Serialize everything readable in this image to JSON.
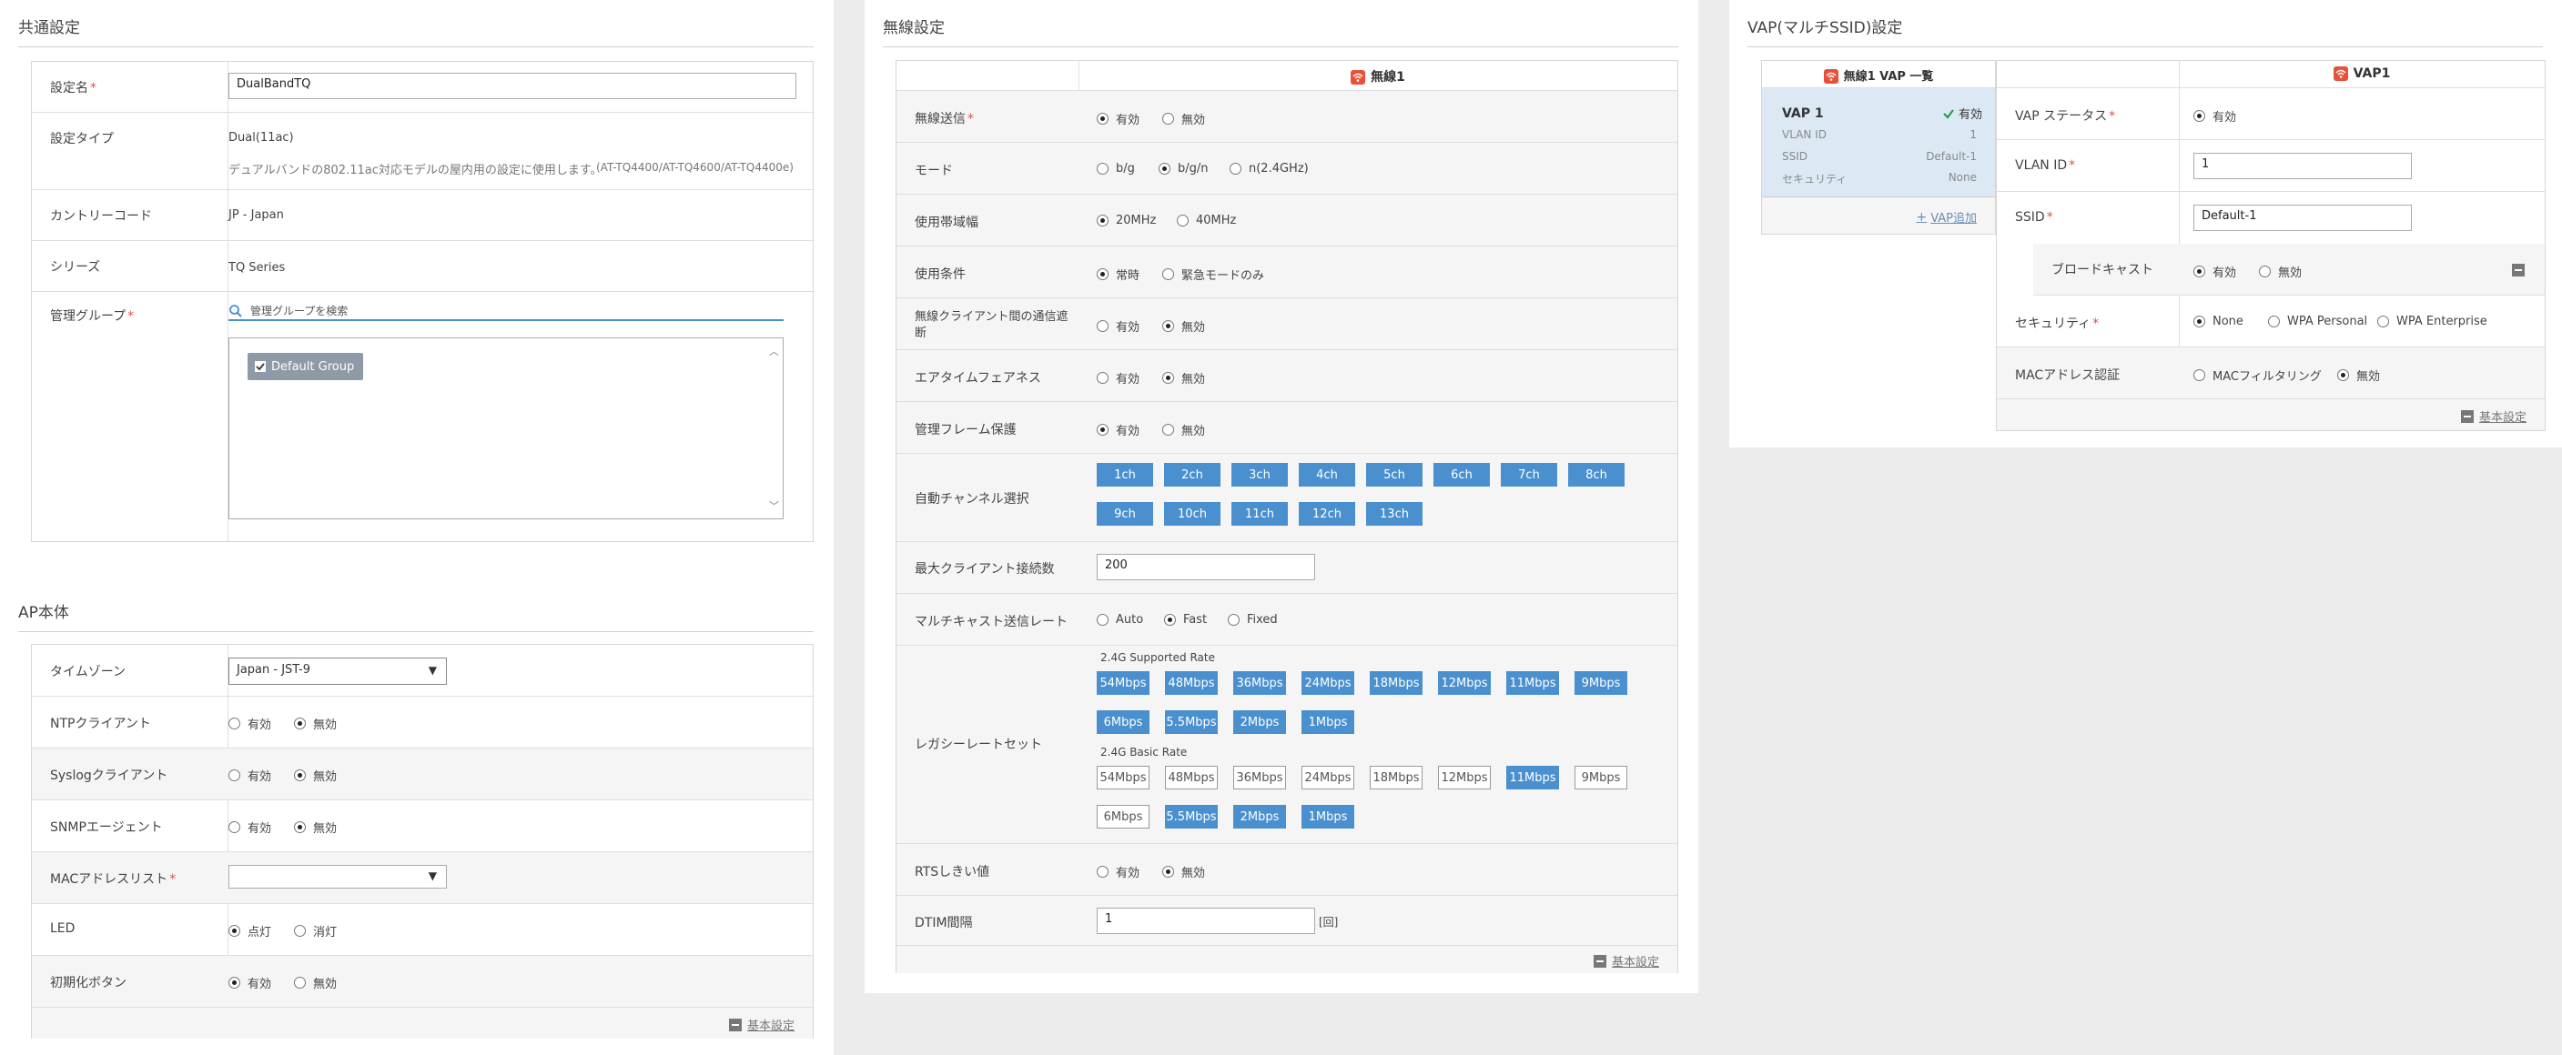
{
  "common": {
    "title": "共通設定",
    "name_label": "設定名",
    "name_value": "DualBandTQ",
    "type_label": "設定タイプ",
    "type_value": "Dual(11ac)",
    "type_desc": "デュアルバンドの802.11ac対応モデルの屋内用の設定に使用します。",
    "type_models": "(AT-TQ4400/AT-TQ4600/AT-TQ4400e)",
    "country_label": "カントリーコード",
    "country_value": "JP - Japan",
    "series_label": "シリーズ",
    "series_value": "TQ Series",
    "group_label": "管理グループ",
    "group_search_placeholder": "管理グループを検索",
    "group_item": "Default Group"
  },
  "ap": {
    "title": "AP本体",
    "timezone_label": "タイムゾーン",
    "timezone_value": "Japan - JST-9",
    "ntp_label": "NTPクライアント",
    "syslog_label": "Syslogクライアント",
    "snmp_label": "SNMPエージェント",
    "mac_label": "MACアドレスリスト",
    "mac_value": "",
    "led_label": "LED",
    "led_on": "点灯",
    "led_off": "消灯",
    "init_label": "初期化ボタン",
    "enabled": "有効",
    "disabled": "無効",
    "footer_link": "基本設定"
  },
  "wireless": {
    "title": "無線設定",
    "column_header": "無線1",
    "tx_label": "無線送信",
    "mode_label": "モード",
    "mode_options": [
      "b/g",
      "b/g/n",
      "n(2.4GHz)"
    ],
    "bw_label": "使用帯域幅",
    "bw_options": [
      "20MHz",
      "40MHz"
    ],
    "cond_label": "使用条件",
    "cond_options": [
      "常時",
      "緊急モードのみ"
    ],
    "isolation_label": "無線クライアント間の通信遮断",
    "airtime_label": "エアタイムフェアネス",
    "mgmt_label": "管理フレーム保護",
    "channel_label": "自動チャンネル選択",
    "channels": [
      "1ch",
      "2ch",
      "3ch",
      "4ch",
      "5ch",
      "6ch",
      "7ch",
      "8ch",
      "9ch",
      "10ch",
      "11ch",
      "12ch",
      "13ch"
    ],
    "maxclient_label": "最大クライアント接続数",
    "maxclient_value": "200",
    "multicast_label": "マルチキャスト送信レート",
    "multicast_options": [
      "Auto",
      "Fast",
      "Fixed"
    ],
    "legacy_label": "レガシーレートセット",
    "supported_title": "2.4G Supported Rate",
    "basic_title": "2.4G Basic Rate",
    "rates": [
      "54Mbps",
      "48Mbps",
      "36Mbps",
      "24Mbps",
      "18Mbps",
      "12Mbps",
      "11Mbps",
      "9Mbps",
      "6Mbps",
      "5.5Mbps",
      "2Mbps",
      "1Mbps"
    ],
    "basic_selected": [
      false,
      false,
      false,
      false,
      false,
      false,
      true,
      false,
      false,
      true,
      true,
      true
    ],
    "rts_label": "RTSしきい値",
    "dtim_label": "DTIM間隔",
    "dtim_value": "1",
    "dtim_unit": "[回]",
    "enabled": "有効",
    "disabled": "無効",
    "footer_link": "基本設定"
  },
  "vap": {
    "title": "VAP(マルチSSID)設定",
    "list_header": "無線1 VAP 一覧",
    "detail_header": "VAP1",
    "item_name": "VAP 1",
    "item_status": "有効",
    "item_vlan_label": "VLAN ID",
    "item_vlan_value": "1",
    "item_ssid_label": "SSID",
    "item_ssid_value": "Default-1",
    "item_sec_label": "セキュリティ",
    "item_sec_value": "None",
    "add_link": "VAP追加",
    "status_label": "VAP ステータス",
    "vlan_label": "VLAN ID",
    "vlan_value": "1",
    "ssid_label": "SSID",
    "ssid_value": "Default-1",
    "broadcast_label": "ブロードキャスト",
    "security_label": "セキュリティ",
    "security_options": [
      "None",
      "WPA Personal",
      "WPA Enterprise"
    ],
    "macauth_label": "MACアドレス認証",
    "macauth_options": [
      "MACフィルタリング",
      "無効"
    ],
    "enabled": "有効",
    "disabled": "無効",
    "footer_link": "基本設定"
  },
  "colors": {
    "accent": "#4a90cf",
    "required": "#d9534f",
    "wifi_badge": "#e8503a",
    "status_ok": "#2e9b3e"
  }
}
